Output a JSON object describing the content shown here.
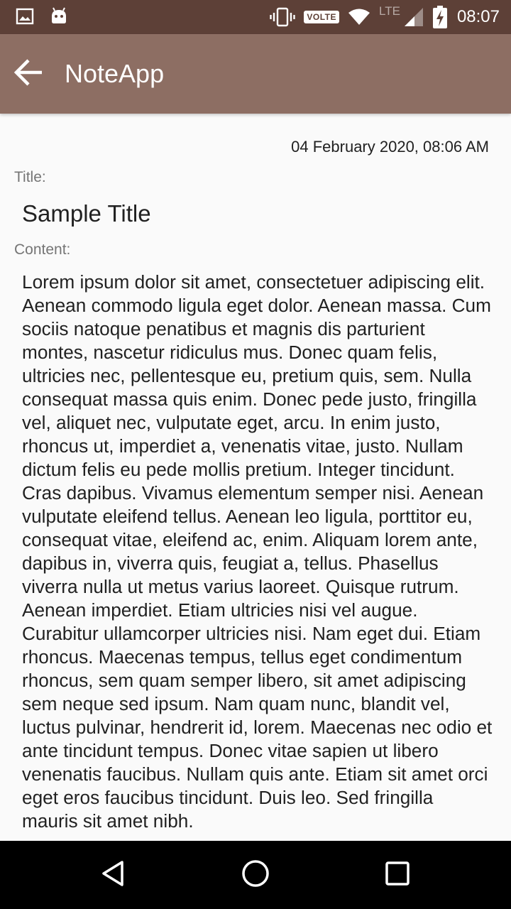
{
  "status_bar": {
    "left_icons": [
      "image-icon",
      "android-icon"
    ],
    "right_icons": [
      "vibrate-icon",
      "wifi-icon",
      "signal-icon",
      "battery-charging-icon"
    ],
    "volte_label": "VOLTE",
    "network_label": "LTE",
    "time": "08:07"
  },
  "app_bar": {
    "title": "NoteApp",
    "back_icon": "arrow-back-icon"
  },
  "note": {
    "timestamp": "04 February 2020, 08:06 AM",
    "title_label": "Title:",
    "title": "Sample Title",
    "content_label": "Content:",
    "content": "Lorem ipsum dolor sit amet, consectetuer adipiscing elit. Aenean commodo ligula eget dolor. Aenean massa. Cum sociis natoque penatibus et magnis dis parturient montes, nascetur ridiculus mus. Donec quam felis, ultricies nec, pellentesque eu, pretium quis, sem. Nulla consequat massa quis enim. Donec pede justo, fringilla vel, aliquet nec, vulputate eget, arcu. In enim justo, rhoncus ut, imperdiet a, venenatis vitae, justo. Nullam dictum felis eu pede mollis pretium. Integer tincidunt. Cras dapibus. Vivamus elementum semper nisi. Aenean vulputate eleifend tellus. Aenean leo ligula, porttitor eu, consequat vitae, eleifend ac, enim. Aliquam lorem ante, dapibus in, viverra quis, feugiat a, tellus. Phasellus viverra nulla ut metus varius laoreet. Quisque rutrum. Aenean imperdiet. Etiam ultricies nisi vel augue. Curabitur ullamcorper ultricies nisi. Nam eget dui. Etiam rhoncus. Maecenas tempus, tellus eget condimentum rhoncus, sem quam semper libero, sit amet adipiscing sem neque sed ipsum. Nam quam nunc, blandit vel, luctus pulvinar, hendrerit id, lorem. Maecenas nec odio et ante tincidunt tempus. Donec vitae sapien ut libero venenatis faucibus. Nullam quis ante. Etiam sit amet orci eget eros faucibus tincidunt. Duis leo. Sed fringilla mauris sit amet nibh."
  },
  "nav_bar": {
    "buttons": [
      "back-triangle-icon",
      "home-circle-icon",
      "recents-square-icon"
    ]
  },
  "colors": {
    "status_bar": "#5d4037",
    "app_bar": "#8d6e63",
    "background": "#fafafa",
    "text_primary": "#212121",
    "text_secondary": "#757575"
  }
}
